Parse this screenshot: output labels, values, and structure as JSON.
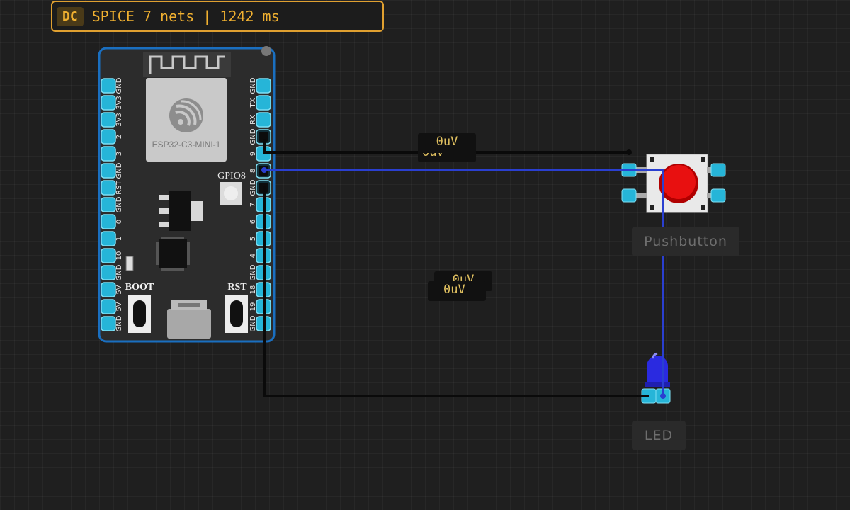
{
  "status": {
    "mode": "DC",
    "engine": "SPICE",
    "net_count": "7 nets",
    "separator": "|",
    "time": "1242 ms"
  },
  "board": {
    "module_label": "ESP32-C3-MINI-1",
    "gpio8_label": "GPIO8",
    "boot_label": "BOOT",
    "rst_label": "RST",
    "left_pins": [
      "GND",
      "3V3",
      "3V3",
      "2",
      "3",
      "GND",
      "RST",
      "GND",
      "0",
      "1",
      "10",
      "GND",
      "5V",
      "5V",
      "GND"
    ],
    "right_pins": [
      "GND",
      "TX",
      "RX",
      "GND",
      "9",
      "8",
      "GND",
      "7",
      "6",
      "5",
      "4",
      "GND",
      "18",
      "19",
      "GND"
    ]
  },
  "probes": {
    "top": "0uV",
    "top_shadow": "0uV",
    "middle_back": "0uV",
    "middle_front": "0uV"
  },
  "components": {
    "pushbutton_label": "Pushbutton",
    "led_label": "LED"
  },
  "colors": {
    "accent": "#e0a030",
    "board_outline": "#1a6fc0",
    "pin": "#26b5d8",
    "wire_gnd": "#0a0a0a",
    "wire_signal": "#2a3fd0",
    "button_cap": "#e01010",
    "led_body": "#2a2ae0"
  }
}
